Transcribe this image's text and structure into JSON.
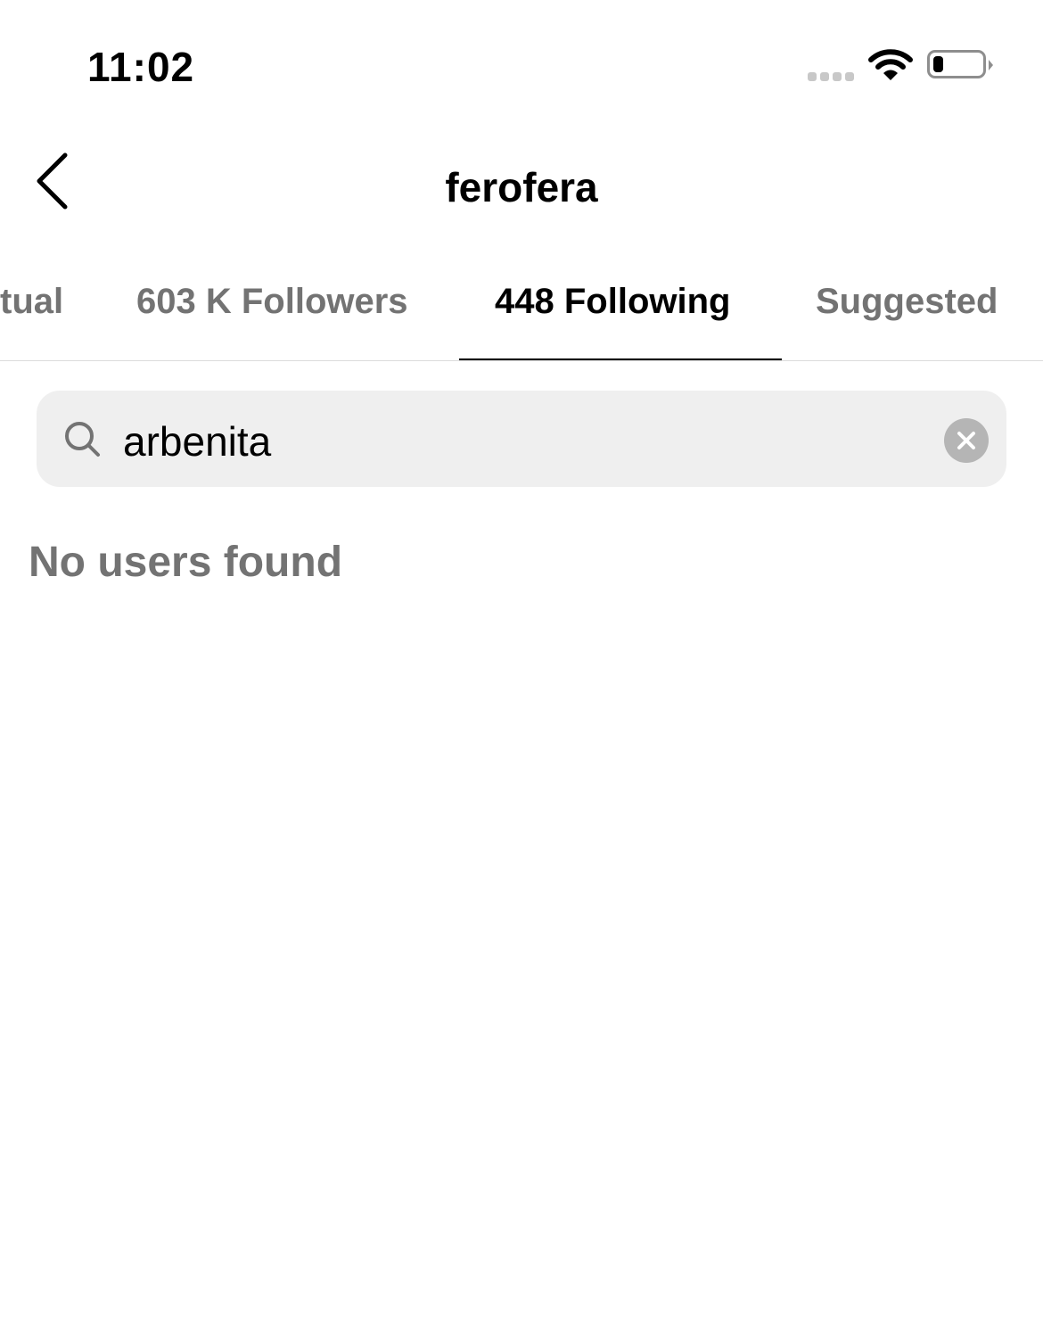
{
  "status_bar": {
    "time": "11:02",
    "battery_level_percent": 20,
    "icons": [
      "signal-dots-icon",
      "wifi-icon",
      "battery-icon"
    ]
  },
  "header": {
    "title": "ferofera",
    "back_icon": "chevron-left-icon"
  },
  "tabs": [
    {
      "label": "tual"
    },
    {
      "label": "603 K Followers"
    },
    {
      "label": "448 Following",
      "active": true
    },
    {
      "label": "Suggested"
    }
  ],
  "search": {
    "value": "arbenita",
    "icon": "search-icon",
    "clear_icon": "clear-icon"
  },
  "results": {
    "empty_message": "No users found"
  }
}
